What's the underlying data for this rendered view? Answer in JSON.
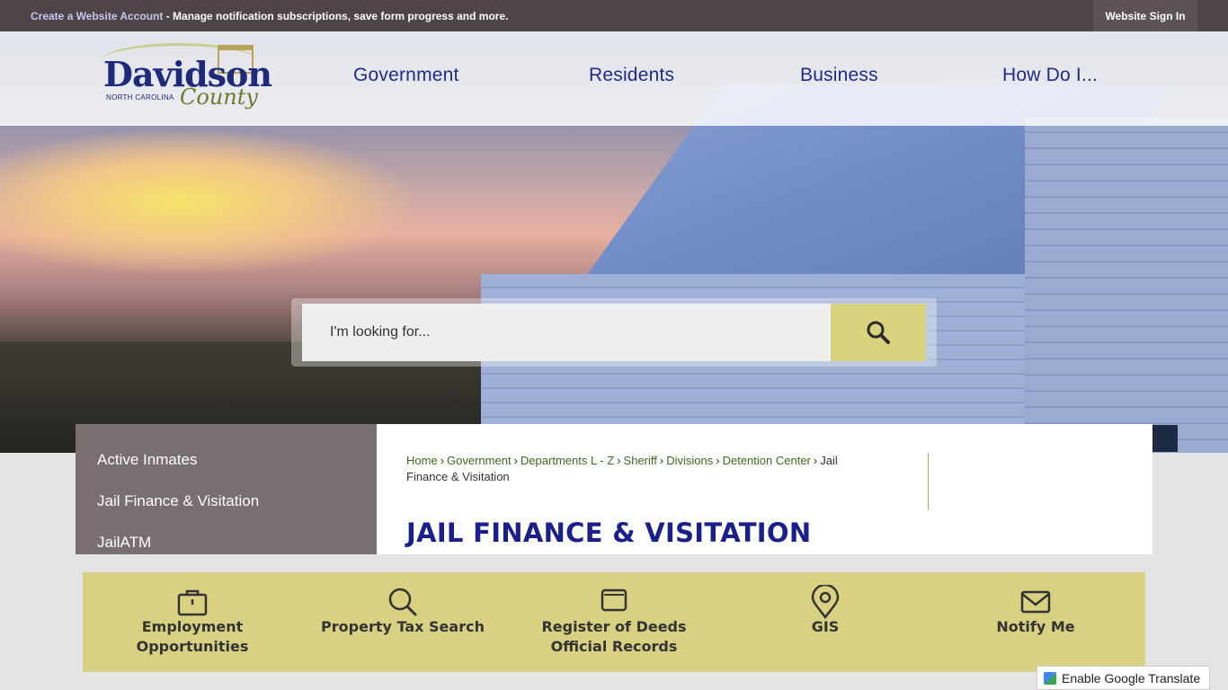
{
  "topbar": {
    "create_account_link": "Create a Website Account",
    "create_account_rest": " - Manage notification subscriptions, save form progress and more.",
    "sign_in": "Website Sign In"
  },
  "logo": {
    "name": "Davidson",
    "state": "NORTH CAROLINA",
    "county": "County"
  },
  "nav": [
    "Government",
    "Residents",
    "Business",
    "How Do I..."
  ],
  "search": {
    "placeholder": "I'm looking for..."
  },
  "sidebar": {
    "items": [
      "Active Inmates",
      "Jail Finance & Visitation",
      "JailATM"
    ]
  },
  "breadcrumb": {
    "items": [
      "Home",
      "Government",
      "Departments L - Z",
      "Sheriff",
      "Divisions",
      "Detention Center"
    ],
    "separator": "›",
    "current": "Jail Finance & Visitation"
  },
  "page_title": "JAIL FINANCE & VISITATION",
  "quick_links": [
    {
      "label_line1": "Employment",
      "label_line2": "Opportunities",
      "icon": "briefcase-icon"
    },
    {
      "label_line1": "Property Tax Search",
      "label_line2": "",
      "icon": "search-icon"
    },
    {
      "label_line1": "Register of Deeds",
      "label_line2": "Official Records",
      "icon": "folder-icon"
    },
    {
      "label_line1": "GIS",
      "label_line2": "",
      "icon": "map-pin-icon"
    },
    {
      "label_line1": "Notify Me",
      "label_line2": "",
      "icon": "envelope-icon"
    }
  ],
  "translate": {
    "label": "Enable Google Translate"
  },
  "colors": {
    "topbar": "#4f4447",
    "nav_text": "#1f2a8c",
    "accent_gold": "#d8d182",
    "sidebar": "#7a6f70",
    "breadcrumb_link": "#3c6b1e",
    "title": "#1a1f8c"
  }
}
